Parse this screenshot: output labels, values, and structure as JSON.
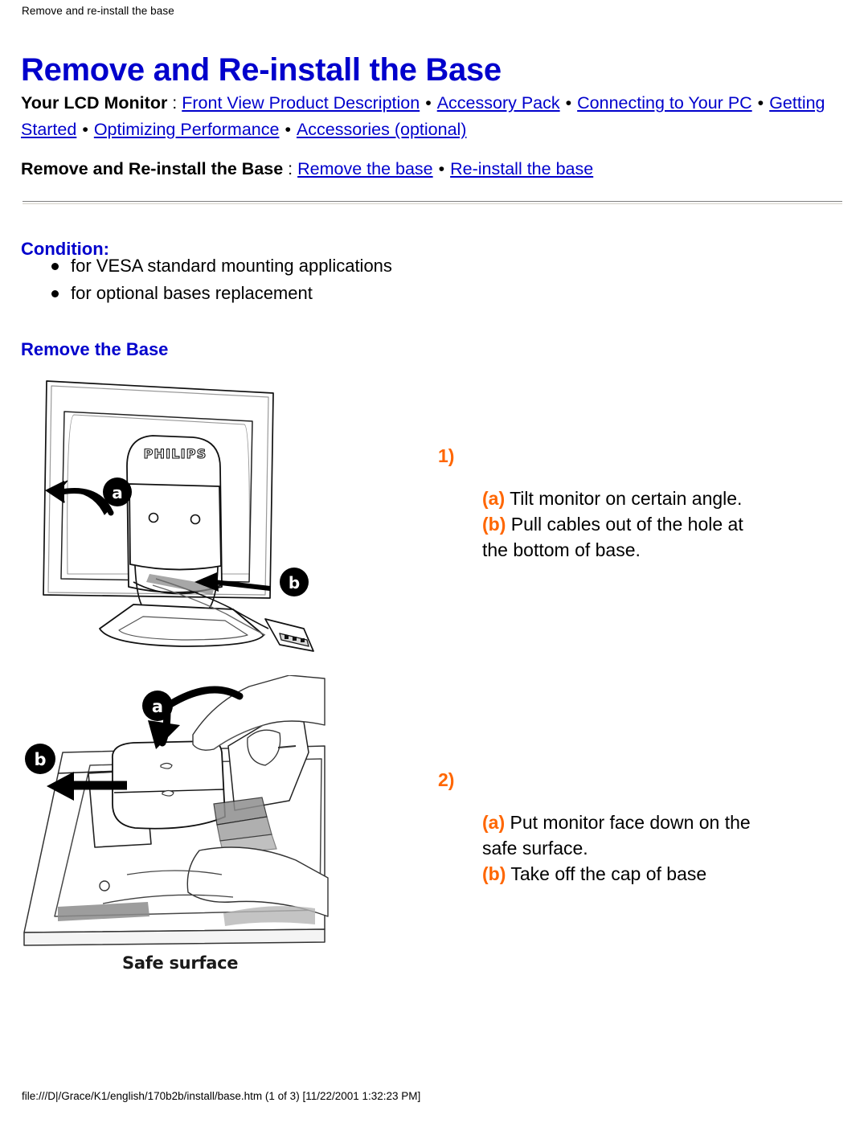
{
  "document": {
    "running_head": "Remove and re-install the base",
    "title": "Remove and Re-install the Base",
    "footer": "file:///D|/Grace/K1/english/170b2b/install/base.htm (1 of 3) [11/22/2001 1:32:23 PM]"
  },
  "colors": {
    "heading_blue": "#0000CC",
    "link_blue": "#0000CC",
    "accent_orange": "#FF6600",
    "text_black": "#000000",
    "rule_gray": "#808080"
  },
  "nav_monitor": {
    "lead": "Your LCD Monitor",
    "colon": " : ",
    "links": [
      "Front View Product Description",
      "Accessory Pack",
      "Connecting to Your PC",
      "Getting Started",
      "Optimizing Performance",
      "Accessories (optional)"
    ],
    "separator": "•"
  },
  "nav_base": {
    "lead": "Remove and Re-install the Base",
    "colon": " : ",
    "links": [
      "Remove the base",
      "Re-install the base"
    ],
    "separator": "•"
  },
  "condition": {
    "heading": "Condition:",
    "items": [
      "for VESA standard mounting applications",
      "for optional bases replacement"
    ]
  },
  "remove_base": {
    "heading": "Remove the Base"
  },
  "steps": [
    {
      "number": "1)",
      "lines": [
        {
          "marker": "(a)",
          "text": " Tilt monitor on certain angle."
        },
        {
          "marker": "(b)",
          "text": " Pull cables out of the hole at the bottom of base."
        }
      ]
    },
    {
      "number": "2)",
      "lines": [
        {
          "marker": "(a)",
          "text": " Put monitor face down on the safe surface."
        },
        {
          "marker": "(b)",
          "text": " Take off the cap of base"
        }
      ]
    }
  ],
  "figures": {
    "figure1": {
      "caption": "",
      "brand_logo": "PHILIPS",
      "callouts": [
        "a",
        "b"
      ]
    },
    "figure2": {
      "caption": "Safe surface",
      "callouts": [
        "a",
        "b"
      ]
    }
  }
}
